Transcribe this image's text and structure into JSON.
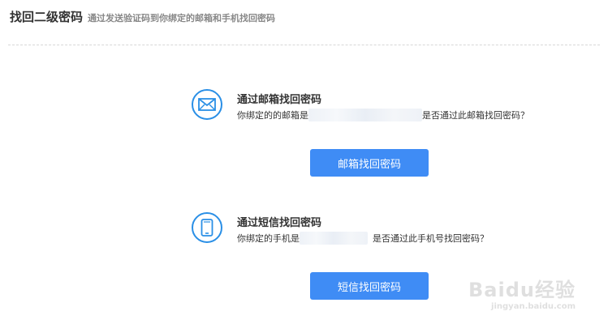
{
  "header": {
    "title": "找回二级密码",
    "subtitle": "通过发送验证码到你绑定的邮箱和手机找回密码"
  },
  "email_option": {
    "icon": "envelope-icon",
    "heading": "通过邮箱找回密码",
    "desc_prefix": "你绑定的的邮箱是",
    "desc_suffix": "是否通过此邮箱找回密码？",
    "button_label": "邮箱找回密码"
  },
  "sms_option": {
    "icon": "phone-icon",
    "heading": "通过短信找回密码",
    "desc_prefix": "你绑定的手机是",
    "desc_suffix": "是否通过此手机号找回密码？",
    "button_label": "短信找回密码"
  },
  "watermark": {
    "main": "Baidu经验",
    "sub": "jingyan.baidu.com"
  },
  "colors": {
    "accent": "#2a8fe6",
    "button": "#3f8cf5"
  }
}
